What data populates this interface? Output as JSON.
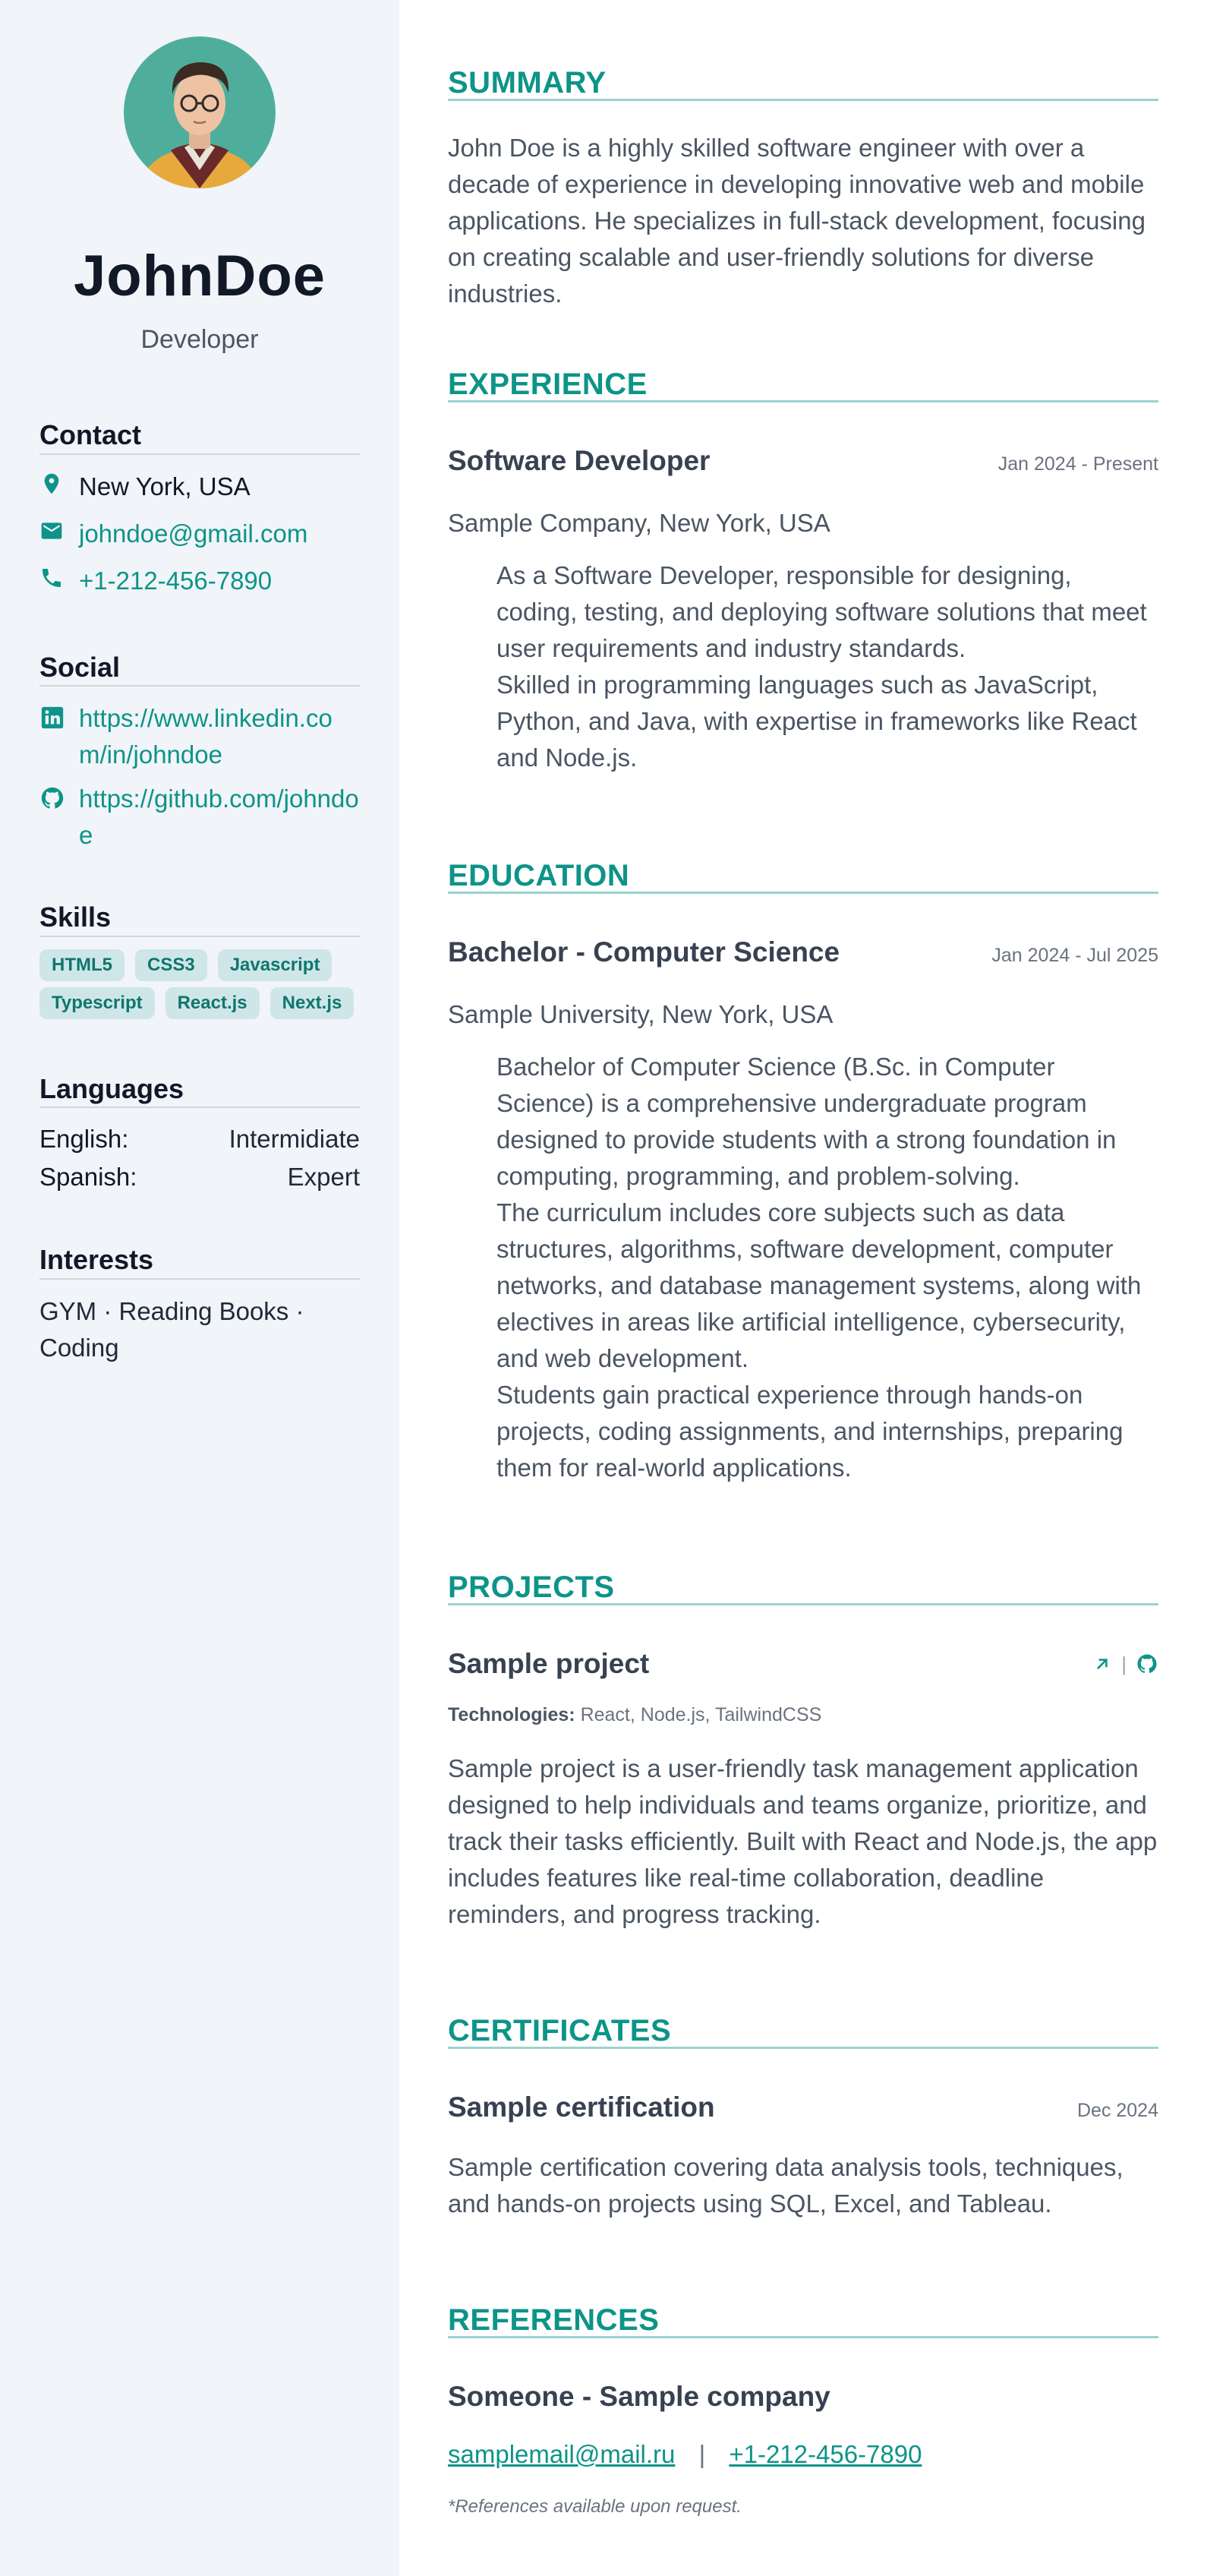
{
  "profile": {
    "name": "JohnDoe",
    "role": "Developer"
  },
  "contact": {
    "heading": "Contact",
    "location": "New York, USA",
    "email": "johndoe@gmail.com",
    "phone": "+1-212-456-7890"
  },
  "social": {
    "heading": "Social",
    "linkedin": "https://www.linkedin.com/in/johndoe",
    "github": "https://github.com/johndoe"
  },
  "skills": {
    "heading": "Skills",
    "items": [
      "HTML5",
      "CSS3",
      "Javascript",
      "Typescript",
      "React.js",
      "Next.js"
    ]
  },
  "languages": {
    "heading": "Languages",
    "items": [
      {
        "name": "English:",
        "level": "Intermidiate"
      },
      {
        "name": "Spanish:",
        "level": "Expert"
      }
    ]
  },
  "interests": {
    "heading": "Interests",
    "text": "GYM · Reading Books · Coding"
  },
  "summary": {
    "heading": "SUMMARY",
    "text": "John Doe is a highly skilled software engineer with over a decade of experience in developing innovative web and mobile applications. He specializes in full-stack development, focusing on creating scalable and user-friendly solutions for diverse industries."
  },
  "experience": {
    "heading": "EXPERIENCE",
    "title": "Software Developer",
    "date": "Jan 2024 - Present",
    "company": "Sample Company, New York, USA",
    "lines": [
      "As a Software Developer, responsible for designing, coding, testing, and deploying software solutions that meet user requirements and industry standards.",
      "Skilled in programming languages such as JavaScript, Python, and Java, with expertise in frameworks like React and Node.js."
    ]
  },
  "education": {
    "heading": "EDUCATION",
    "title": "Bachelor - Computer Science",
    "date": "Jan 2024 - Jul 2025",
    "school": "Sample University, New York, USA",
    "lines": [
      "Bachelor of Computer Science (B.Sc. in Computer Science) is a comprehensive undergraduate program designed to provide students with a strong foundation in computing, programming, and problem-solving.",
      "The curriculum includes core subjects such as data structures, algorithms, software development, computer networks, and database management systems, along with electives in areas like artificial intelligence, cybersecurity, and web development.",
      "Students gain practical experience through hands-on projects, coding assignments, and internships, preparing them for real-world applications."
    ]
  },
  "projects": {
    "heading": "PROJECTS",
    "title": "Sample project",
    "tech_label": "Technologies:",
    "tech_list": "React, Node.js, TailwindCSS",
    "separator": "|",
    "text": "Sample project is a user-friendly task management application designed to help individuals and teams organize, prioritize, and track their tasks efficiently. Built with React and Node.js, the app includes features like real-time collaboration, deadline reminders, and progress tracking."
  },
  "certificates": {
    "heading": "CERTIFICATES",
    "title": "Sample certification",
    "date": "Dec 2024",
    "text": "Sample certification covering data analysis tools, techniques, and hands-on projects using SQL, Excel, and Tableau."
  },
  "references": {
    "heading": "REFERENCES",
    "title": "Someone - Sample company",
    "email": "samplemail@mail.ru",
    "separator": "|",
    "phone": "+1-212-456-7890",
    "note": "*References available upon request."
  },
  "colors": {
    "accent": "#0d9488",
    "sidebar_bg": "#f1f4f9",
    "skill_bg": "#cfe6e8",
    "heading_rule": "#99d3d0"
  }
}
